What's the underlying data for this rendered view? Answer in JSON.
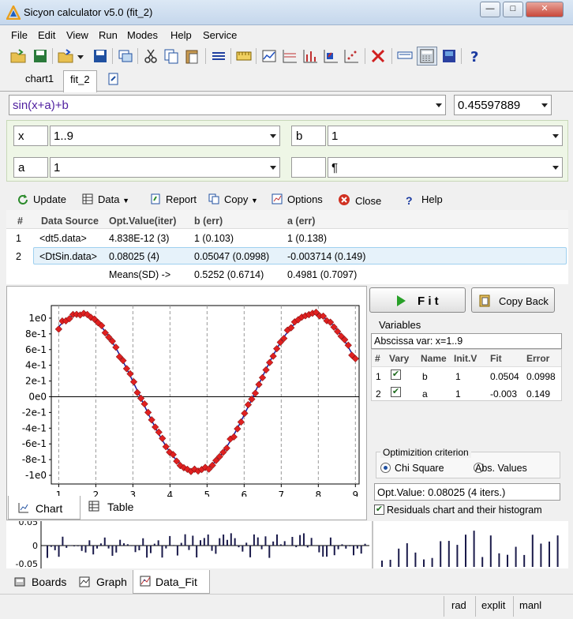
{
  "window": {
    "title": "Sicyon calculator v5.0 (fit_2)",
    "min_glyph": "—",
    "max_glyph": "□",
    "close_glyph": "✕"
  },
  "menu": [
    "File",
    "Edit",
    "View",
    "Run",
    "Modes",
    "Help",
    "Service"
  ],
  "doc_tabs": [
    "chart1",
    "fit_2"
  ],
  "formula": {
    "expression": "sin(x+a)+b",
    "result": "0.45597889"
  },
  "vars": [
    {
      "name": "x",
      "value": "1..9"
    },
    {
      "name": "b",
      "value": "1"
    },
    {
      "name": "a",
      "value": "1"
    },
    {
      "name": "",
      "value": "¶"
    }
  ],
  "fit_toolbar": {
    "update": "Update",
    "data": "Data",
    "report": "Report",
    "copy": "Copy",
    "options": "Options",
    "close": "Close",
    "help": "Help"
  },
  "grid": {
    "headers": [
      "#",
      "Data Source",
      "Opt.Value(iter)",
      "b (err)",
      "a (err)"
    ],
    "rows": [
      [
        "1",
        "<dt5.data>",
        "4.838E-12 (3)",
        "1 (0.103)",
        "1 (0.138)"
      ],
      [
        "2",
        "<DtSin.data>",
        "0.08025 (4)",
        "0.05047 (0.0998)",
        "-0.003714 (0.149)"
      ],
      [
        "",
        "",
        "Means(SD) ->",
        "0.5252 (0.6714)",
        "0.4981 (0.7097)"
      ]
    ]
  },
  "chart_tabs": [
    "Chart",
    "Table"
  ],
  "chart_data": {
    "type": "scatter",
    "title": "",
    "xlabel": "",
    "ylabel": "",
    "xlim": [
      0.8,
      9.1
    ],
    "ylim": [
      -1.05,
      1.1
    ],
    "x_ticks": [
      "1",
      "2",
      "3",
      "4",
      "5",
      "6",
      "7",
      "8",
      "9"
    ],
    "y_ticks": [
      "1e0",
      "8e-1",
      "6e-1",
      "4e-1",
      "2e-1",
      "0e0",
      "-2e-1",
      "-4e-1",
      "-6e-1",
      "-8e-1",
      "-1e0"
    ],
    "grid": "vertical",
    "series": [
      {
        "role": "data points",
        "color": "#e02020",
        "fn": "sin(x-0.003714)+0.05047",
        "x_from": 1.0,
        "x_to": 9.0,
        "n": 84
      },
      {
        "role": "fitted curve",
        "color": "#1a1aa0",
        "fn": "sin(x-0.003714)+0.05047"
      }
    ],
    "noise_sd": 0.03
  },
  "right": {
    "fit_label": "F i t",
    "copyback_label": "Copy Back",
    "variables_title": "Variables",
    "abscissa": "Abscissa var: x=1..9",
    "var_headers": [
      "#",
      "Vary",
      "Name",
      "Init.V",
      "Fit",
      "Error"
    ],
    "var_rows": [
      [
        "1",
        "✔",
        "b",
        "1",
        "0.0504",
        "0.0998"
      ],
      [
        "2",
        "✔",
        "a",
        "1",
        "-0.003",
        "0.149"
      ]
    ],
    "criterion_title": "Optimizition criterion",
    "chi": "Chi Square",
    "abs": "Abs. Values",
    "optvalue": "Opt.Value: 0.08025 (4 iters.)",
    "residuals_label": "Residuals chart and their histogram"
  },
  "resid_ticks": [
    "0.05",
    "0",
    "-0.05"
  ],
  "main_tabs": [
    "Boards",
    "Graph",
    "Data_Fit"
  ],
  "status": [
    "rad",
    "explit",
    "manl"
  ]
}
